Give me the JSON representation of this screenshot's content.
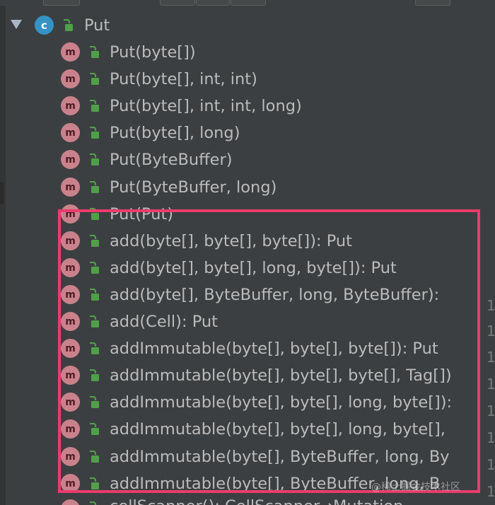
{
  "tree": {
    "class_node": {
      "badge": "c",
      "label": "Put",
      "expanded": true,
      "icon": "unlocked-icon"
    },
    "methods": [
      {
        "badge": "m",
        "label": "Put(byte[])"
      },
      {
        "badge": "m",
        "label": "Put(byte[], int, int)"
      },
      {
        "badge": "m",
        "label": "Put(byte[], int, int, long)"
      },
      {
        "badge": "m",
        "label": "Put(byte[], long)"
      },
      {
        "badge": "m",
        "label": "Put(ByteBuffer)"
      },
      {
        "badge": "m",
        "label": "Put(ByteBuffer, long)"
      },
      {
        "badge": "m",
        "label": "Put(Put)"
      },
      {
        "badge": "m",
        "label": "add(byte[], byte[], byte[]): Put"
      },
      {
        "badge": "m",
        "label": "add(byte[], byte[], long, byte[]): Put"
      },
      {
        "badge": "m",
        "label": "add(byte[], ByteBuffer, long, ByteBuffer):"
      },
      {
        "badge": "m",
        "label": "add(Cell): Put"
      },
      {
        "badge": "m",
        "label": "addImmutable(byte[], byte[], byte[]): Put"
      },
      {
        "badge": "m",
        "label": "addImmutable(byte[], byte[], byte[], Tag[])"
      },
      {
        "badge": "m",
        "label": "addImmutable(byte[], byte[], long, byte[]):"
      },
      {
        "badge": "m",
        "label": "addImmutable(byte[], byte[], long, byte[],"
      },
      {
        "badge": "m",
        "label": "addImmutable(byte[], ByteBuffer, long, By"
      },
      {
        "badge": "m",
        "label": "addImmutable(byte[], ByteBuffer, long, B"
      }
    ],
    "partial_method": {
      "badge": "m",
      "label": "cellScanner(): CellScanner→Mutation"
    }
  },
  "right_column_digits": [
    "1",
    "1",
    "1",
    "1",
    "1",
    "1",
    "1",
    "1"
  ],
  "watermark": "@稀土掘金技术社区",
  "colors": {
    "background": "#3c3f41",
    "text": "#bbbbbb",
    "class_badge": "#3592c4",
    "method_badge": "#c9828b",
    "lock_icon": "#4fa048",
    "highlight_border": "#ea3c6d"
  }
}
